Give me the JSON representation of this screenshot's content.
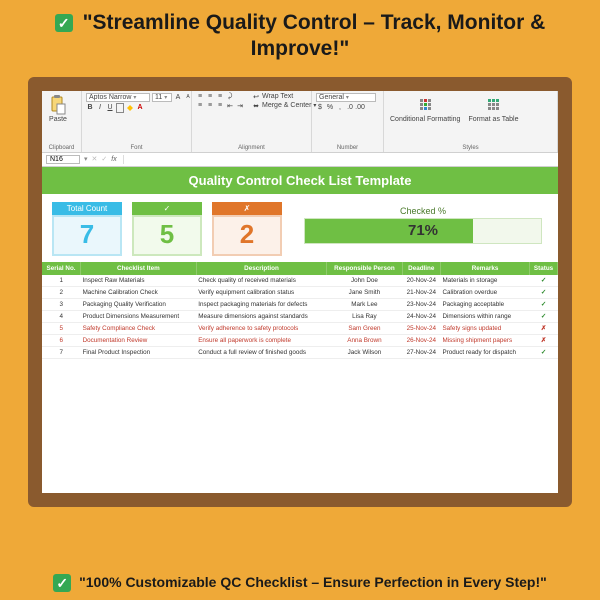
{
  "hero": {
    "top": "\"Streamline Quality Control – Track, Monitor & Improve!\"",
    "bottom": "\"100% Customizable QC Checklist – Ensure Perfection in Every Step!\""
  },
  "ribbon": {
    "paste": "Paste",
    "clipboard_label": "Clipboard",
    "font_name": "Aptos Narrow",
    "font_size": "11",
    "font_label": "Font",
    "wrap": "Wrap Text",
    "merge": "Merge & Center",
    "align_label": "Alignment",
    "num_format": "General",
    "number_label": "Number",
    "cond_fmt": "Conditional Formatting",
    "fmt_table": "Format as Table",
    "styles_label": "Styles"
  },
  "formula_bar": {
    "cell_ref": "N16"
  },
  "sheet": {
    "title": "Quality Control Check List Template",
    "cards": {
      "total_label": "Total Count",
      "total_value": "7",
      "pass_symbol": "✓",
      "pass_value": "5",
      "fail_symbol": "✗",
      "fail_value": "2"
    },
    "pct": {
      "label": "Checked %",
      "value": "71%",
      "width": "71%"
    },
    "headers": {
      "serial": "Serial No.",
      "item": "Checklist Item",
      "desc": "Description",
      "person": "Responsible Person",
      "deadline": "Deadline",
      "remarks": "Remarks",
      "status": "Status"
    },
    "rows": [
      {
        "n": "1",
        "item": "Inspect Raw Materials",
        "desc": "Check quality of received materials",
        "person": "John Doe",
        "deadline": "20-Nov-24",
        "remarks": "Materials in storage",
        "status": "✓",
        "ok": true
      },
      {
        "n": "2",
        "item": "Machine Calibration Check",
        "desc": "Verify equipment calibration status",
        "person": "Jane Smith",
        "deadline": "21-Nov-24",
        "remarks": "Calibration overdue",
        "status": "✓",
        "ok": true
      },
      {
        "n": "3",
        "item": "Packaging Quality Verification",
        "desc": "Inspect packaging materials for defects",
        "person": "Mark Lee",
        "deadline": "23-Nov-24",
        "remarks": "Packaging acceptable",
        "status": "✓",
        "ok": true
      },
      {
        "n": "4",
        "item": "Product Dimensions Measurement",
        "desc": "Measure dimensions against standards",
        "person": "Lisa Ray",
        "deadline": "24-Nov-24",
        "remarks": "Dimensions within range",
        "status": "✓",
        "ok": true
      },
      {
        "n": "5",
        "item": "Safety Compliance Check",
        "desc": "Verify adherence to safety protocols",
        "person": "Sam Green",
        "deadline": "25-Nov-24",
        "remarks": "Safety signs updated",
        "status": "✗",
        "ok": false
      },
      {
        "n": "6",
        "item": "Documentation Review",
        "desc": "Ensure all paperwork is complete",
        "person": "Anna Brown",
        "deadline": "26-Nov-24",
        "remarks": "Missing shipment papers",
        "status": "✗",
        "ok": false
      },
      {
        "n": "7",
        "item": "Final Product Inspection",
        "desc": "Conduct a full review of finished goods",
        "person": "Jack Wilson",
        "deadline": "27-Nov-24",
        "remarks": "Product ready for dispatch",
        "status": "✓",
        "ok": true
      }
    ]
  }
}
